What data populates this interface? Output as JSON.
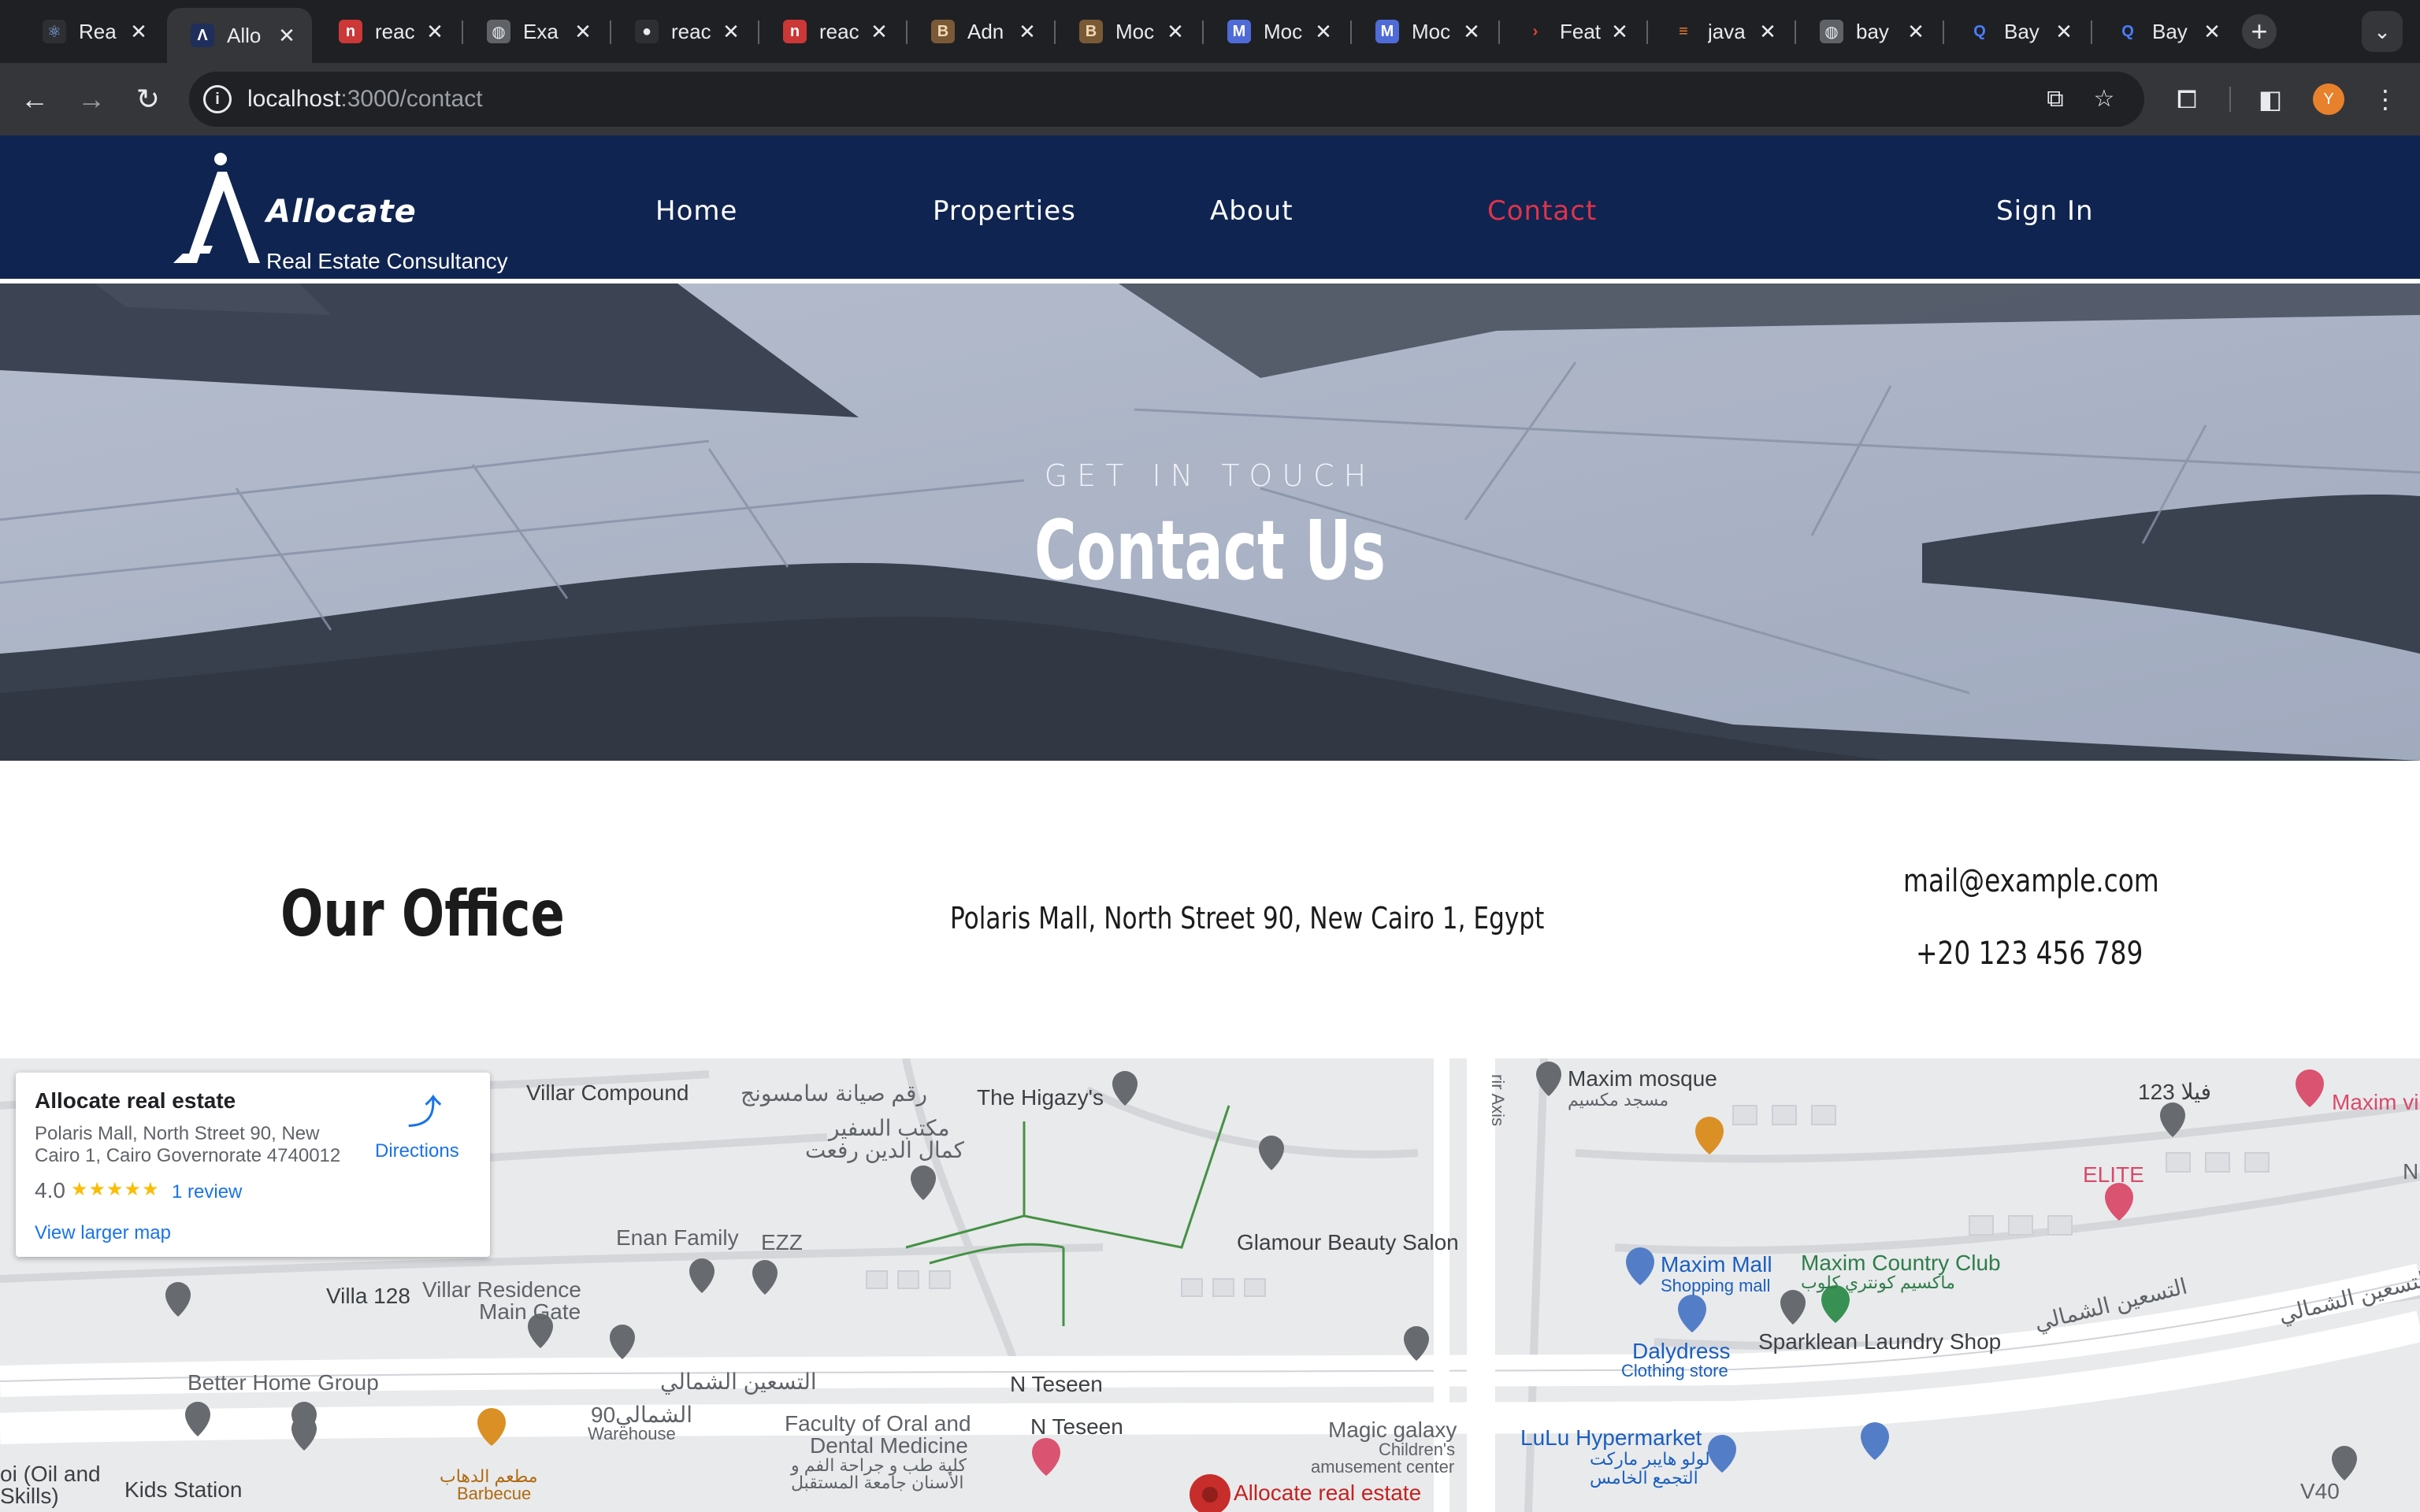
{
  "browser": {
    "tabs": [
      {
        "title": "Rea",
        "favicon": "react-icon",
        "active": false
      },
      {
        "title": "Allo",
        "favicon": "allocate-icon",
        "active": true
      },
      {
        "title": "reac",
        "favicon": "npm-icon",
        "active": false
      },
      {
        "title": "Exa",
        "favicon": "globe-icon",
        "active": false
      },
      {
        "title": "reac",
        "favicon": "github-icon",
        "active": false
      },
      {
        "title": "reac",
        "favicon": "npm-icon",
        "active": false
      },
      {
        "title": "Adn",
        "favicon": "book-icon",
        "active": false
      },
      {
        "title": "Moc",
        "favicon": "book-icon",
        "active": false
      },
      {
        "title": "Moc",
        "favicon": "mockup-icon",
        "active": false
      },
      {
        "title": "Moc",
        "favicon": "mockup-icon",
        "active": false
      },
      {
        "title": "Feat",
        "favicon": "chevron-icon",
        "active": false
      },
      {
        "title": "java",
        "favicon": "stackoverflow-icon",
        "active": false
      },
      {
        "title": "bay",
        "favicon": "globe-icon",
        "active": false
      },
      {
        "title": "Bay",
        "favicon": "q-icon",
        "active": false
      },
      {
        "title": "Bay",
        "favicon": "q-icon",
        "active": false
      }
    ],
    "url_host": "localhost",
    "url_path": ":3000/contact",
    "avatar_initial": "Y"
  },
  "nav": {
    "brand": "Allocate",
    "tagline": "Real Estate Consultancy",
    "links": [
      {
        "label": "Home",
        "active": false
      },
      {
        "label": "Properties",
        "active": false
      },
      {
        "label": "About",
        "active": false
      },
      {
        "label": "Contact",
        "active": true
      },
      {
        "label": "Sign In",
        "active": false
      }
    ]
  },
  "hero": {
    "kicker": "GET IN TOUCH",
    "title": "Contact Us"
  },
  "office": {
    "title": "Our Office",
    "address": "Polaris Mall, North Street 90, New Cairo 1, Egypt",
    "email": "mail@example.com",
    "phone": "+20 123 456 789"
  },
  "map": {
    "card": {
      "name": "Allocate real estate",
      "address": "Polaris Mall, North Street 90, New Cairo 1, Cairo Governorate 4740012",
      "rating": "4.0",
      "stars": "★★★★★",
      "reviews": "1 review",
      "directions": "Directions",
      "larger_map": "View larger map"
    },
    "labels": {
      "villar": "Villar Compound",
      "villar_ar": "رقم صيانة سامسونج",
      "higazy": "The Higazy's",
      "office_ar1": "مكتب السفير",
      "office_ar2": "كمال الدين رفعت",
      "enan": "Enan Family",
      "ezz": "EZZ",
      "glamour": "Glamour Beauty Salon",
      "villa128": "Villa 128",
      "villar_res1": "Villar Residence",
      "villar_res2": "Main Gate",
      "better_home": "Better Home Group",
      "tesseen_ar": "التسعين الشمالي",
      "ninety": "90الشمالي",
      "warehouse": "Warehouse",
      "n_teseen1": "N Teseen",
      "n_teseen2": "N Teseen",
      "faculty1": "Faculty of Oral and",
      "faculty2": "Dental Medicine",
      "faculty_ar1": "كلية طب و جراحة الفم و",
      "faculty_ar2": "الأسنان جامعة المستقبل",
      "kids": "Kids Station",
      "oil1": "oi (Oil and",
      "oil2": "Skills)",
      "barbecue_ar": "مطعم الدهاب",
      "barbecue": "Barbecue",
      "allocate_pin": "Allocate real estate",
      "magic1": "Magic galaxy",
      "magic2": "Children's",
      "magic3": "amusement center",
      "maxim_mosque": "Maxim mosque",
      "maxim_mosque_ar": "مسجد مكسيم",
      "maxim_mall": "Maxim Mall",
      "shopping_mall": "Shopping mall",
      "maxim_club": "Maxim Country Club",
      "maxim_club_ar": "ماكسيم كونتري كلوب",
      "dalydress": "Dalydress",
      "clothing": "Clothing store",
      "sparklean": "Sparklean Laundry Shop",
      "lulu": "LuLu Hypermarket",
      "lulu_ar1": "لولو هايبر ماركت",
      "lulu_ar2": "التجمع الخامس",
      "elite": "ELITE",
      "maxim_vi": "Maxim vi",
      "villa123": "123 فيلا",
      "tesseen_ar2": "التسعين الشمالي",
      "tesseen_ar3": "التسعين الشمالي",
      "axis": "rir Axis",
      "v40": "V40",
      "n_lbl": "N"
    }
  }
}
